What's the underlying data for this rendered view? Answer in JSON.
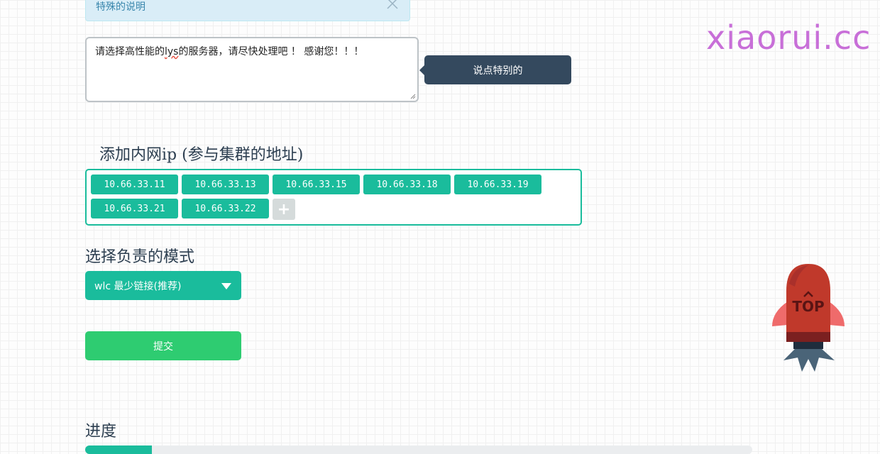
{
  "info_box": {
    "text": "特殊的说明"
  },
  "remark": {
    "text_before": "请选择高性能的",
    "text_highlight": "lys",
    "text_after": "的服务器，请尽快处理吧 ！  感谢您！！！"
  },
  "tooltip": {
    "text": "说点特别的"
  },
  "brand": {
    "text": "xiaorui.cc",
    "color": "#c86fd8"
  },
  "ip_section": {
    "title": "添加内网ip (参与集群的地址)",
    "ips": [
      "10.66.33.11",
      "10.66.33.13",
      "10.66.33.15",
      "10.66.33.18",
      "10.66.33.19",
      "10.66.33.21",
      "10.66.33.22"
    ],
    "add_label": "+"
  },
  "mode_section": {
    "title": "选择负责的模式",
    "selected": "wlc 最少链接(推荐)"
  },
  "submit": {
    "label": "提交"
  },
  "progress_section": {
    "title": "进度",
    "value_percent": 10
  },
  "top_button": {
    "label": "TOP"
  },
  "colors": {
    "accent": "#1abc9c",
    "submit": "#2ecc71",
    "tooltip_bg": "#34495e",
    "rocket_body": "#c0392b"
  }
}
